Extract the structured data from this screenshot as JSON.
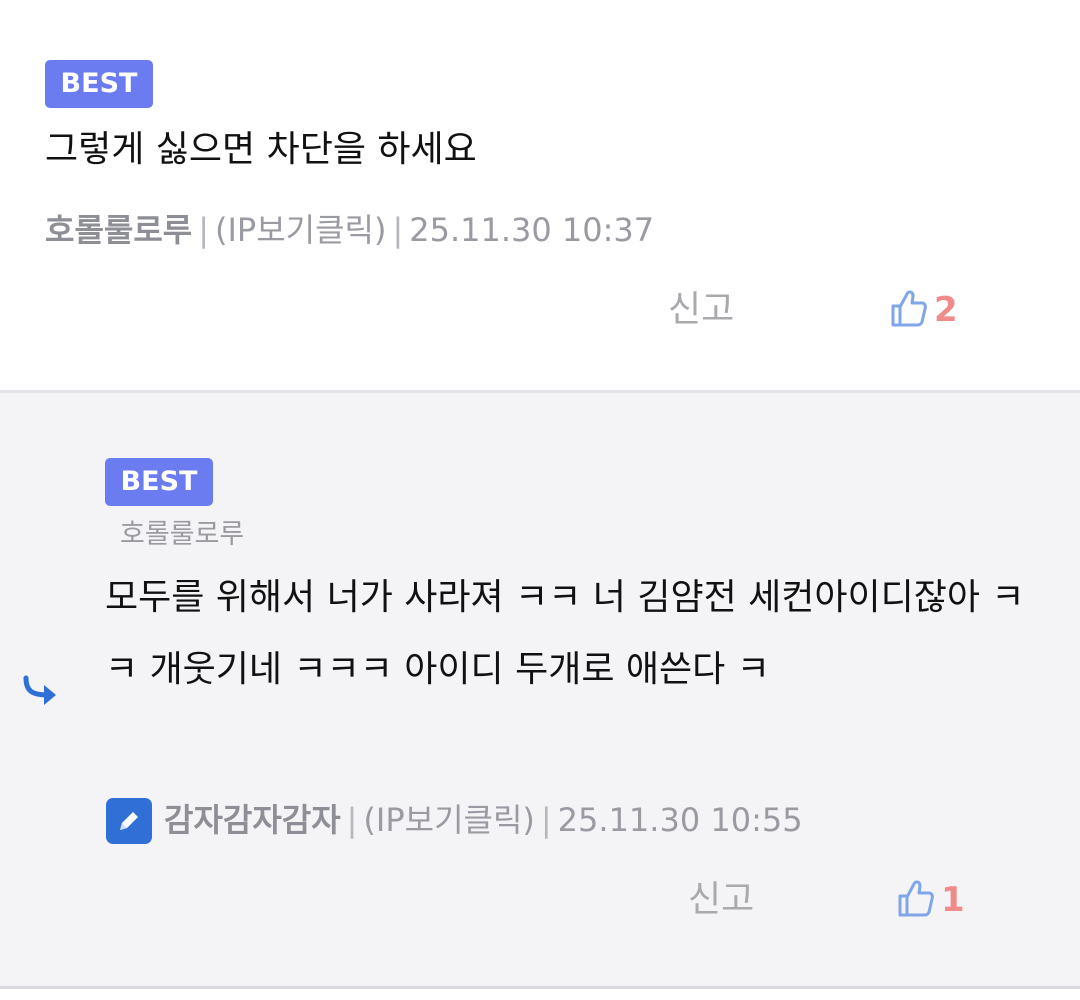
{
  "comment": {
    "badge": "BEST",
    "text": "그렇게 싫으면 차단을 하세요",
    "author": "호롤룰로루",
    "sep": "|",
    "ip": "(IP보기클릭)",
    "date": "25.11.30 10:37",
    "report": "신고",
    "likes": "2"
  },
  "reply": {
    "badge": "BEST",
    "parent_author": "호롤룰로루",
    "text": "모두를 위해서 너가 사라져 ㅋㅋ 너 김얌전 세컨아이디잖아 ㅋㅋ 개웃기네 ㅋㅋㅋ 아이디 두개로 애쓴다 ㅋ",
    "author": "감자감자감자",
    "sep": "|",
    "ip": "(IP보기클릭)",
    "date": "25.11.30 10:55",
    "report": "신고",
    "likes": "1"
  },
  "colors": {
    "badge": "#6b7bf0",
    "like_icon": "#7fa6e8",
    "like_count": "#f08b8b",
    "reply_bg": "#f4f4f6",
    "edit_badge": "#2f6fd6",
    "reply_arrow": "#2f6fd6"
  },
  "icons": {
    "like": "thumbs-up-icon",
    "reply_arrow": "reply-arrow-icon",
    "edit": "pencil-icon"
  }
}
